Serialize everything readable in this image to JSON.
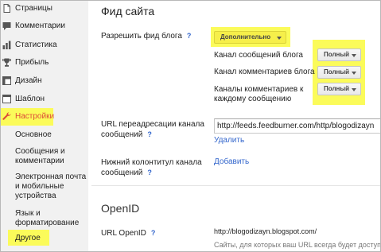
{
  "sidebar": {
    "items": [
      {
        "label": "Страницы",
        "icon": "pages-icon"
      },
      {
        "label": "Комментарии",
        "icon": "comments-icon"
      },
      {
        "label": "Статистика",
        "icon": "stats-icon"
      },
      {
        "label": "Прибыль",
        "icon": "earnings-trophy-icon"
      },
      {
        "label": "Дизайн",
        "icon": "layout-icon"
      },
      {
        "label": "Шаблон",
        "icon": "template-icon"
      },
      {
        "label": "Настройки",
        "icon": "wrench-icon",
        "active": true
      }
    ],
    "subitems": [
      {
        "label": "Основное"
      },
      {
        "label": "Сообщения и комментарии"
      },
      {
        "label": "Электронная почта и мобильные устройства"
      },
      {
        "label": "Язык и форматирование"
      },
      {
        "label": "Другое"
      }
    ]
  },
  "main": {
    "title": "Фид сайта",
    "allow_feed": {
      "label": "Разрешить фид блога",
      "help": "?",
      "value": "Дополнительно"
    },
    "post_feed": {
      "label": "Канал сообщений блога",
      "value": "Полный"
    },
    "comment_feed": {
      "label": "Канал комментариев блога",
      "value": "Полный"
    },
    "per_post_comment_feed": {
      "label": "Каналы комментариев к каждому сообщению",
      "value": "Полный"
    },
    "redirect": {
      "label": "URL переадресации канала сообщений",
      "help": "?",
      "value": "http://feeds.feedburner.com/http/blogodizayn",
      "delete_label": "Удалить"
    },
    "footer": {
      "label": "Нижний колонтитул канала сообщений",
      "help": "?",
      "add_label": "Добавить"
    },
    "openid": {
      "section_title": "OpenID",
      "label": "URL OpenID",
      "help": "?",
      "url": "http://blogodizayn.blogspot.com/",
      "note": "Сайты, для которых ваш URL всегда будет доступе"
    }
  },
  "colors": {
    "highlight": "#fbfb5a",
    "link": "#3366cc",
    "active_nav": "#dd4b39",
    "sidebar_bg": "#f1f1f1"
  }
}
